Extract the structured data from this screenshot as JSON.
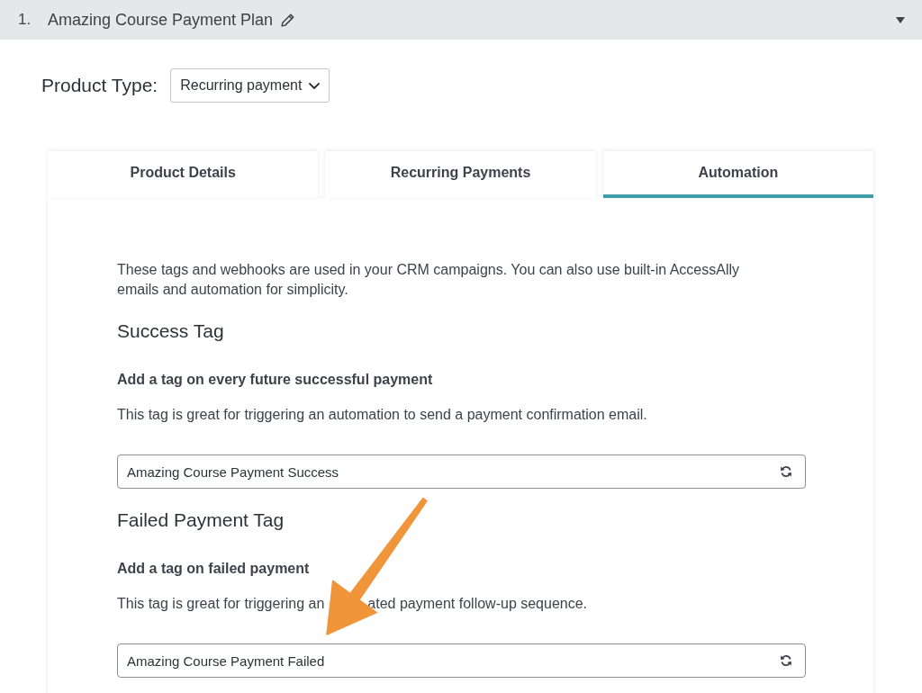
{
  "header": {
    "number": "1.",
    "title": "Amazing Course Payment Plan"
  },
  "product_type": {
    "label": "Product Type:",
    "value": "Recurring payment"
  },
  "tabs": [
    {
      "label": "Product Details",
      "selected": false
    },
    {
      "label": "Recurring Payments",
      "selected": false
    },
    {
      "label": "Automation",
      "selected": true
    }
  ],
  "intro": "These tags and webhooks are used in your CRM campaigns. You can also use built-in AccessAlly emails and automation for simplicity.",
  "sections": [
    {
      "heading": "Success Tag",
      "subheading": "Add a tag on every future successful payment",
      "description": [
        "This tag is great for triggering an automation to send a payment confirmation email."
      ],
      "tag_value": "Amazing Course Payment Success"
    },
    {
      "heading": "Failed Payment Tag",
      "subheading": "Add a tag on failed payment",
      "description": [
        "This tag is great for triggering an",
        "ated payment follow-up sequence."
      ],
      "tag_value": "Amazing Course Payment Failed"
    }
  ]
}
